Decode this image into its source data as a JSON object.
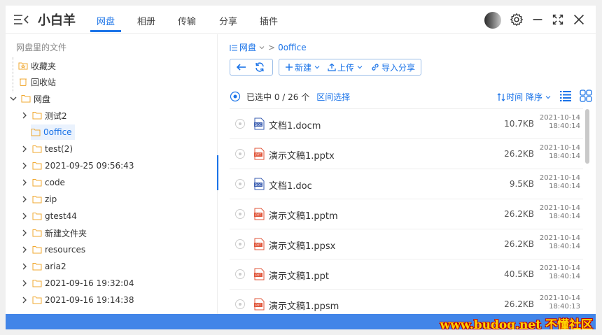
{
  "header": {
    "app_title": "小白羊",
    "tabs": [
      "网盘",
      "相册",
      "传输",
      "分享",
      "插件"
    ],
    "active_tab": "网盘"
  },
  "sidebar": {
    "title": "网盘里的文件",
    "favorites": "收藏夹",
    "recycle": "回收站",
    "root": "网盘",
    "folders": [
      {
        "label": "测试2",
        "selected": false
      },
      {
        "label": "0office",
        "selected": true
      },
      {
        "label": "test(2)",
        "selected": false
      },
      {
        "label": "2021-09-25 09:56:43",
        "selected": false
      },
      {
        "label": "code",
        "selected": false
      },
      {
        "label": "zip",
        "selected": false
      },
      {
        "label": "gtest44",
        "selected": false
      },
      {
        "label": "新建文件夹",
        "selected": false
      },
      {
        "label": "resources",
        "selected": false
      },
      {
        "label": "aria2",
        "selected": false
      },
      {
        "label": "2021-09-16 19:32:04",
        "selected": false
      },
      {
        "label": "2021-09-16 19:14:38",
        "selected": false
      }
    ]
  },
  "main": {
    "breadcrumb": {
      "root": "网盘",
      "current": "0office"
    },
    "toolbar": {
      "new": "新建",
      "upload": "上传",
      "import": "导入分享"
    },
    "selection": {
      "text": "已选中 0 / 26 个",
      "range_select": "区间选择"
    },
    "sort": {
      "label": "时间 降序"
    },
    "files": [
      {
        "name": "文档1.docm",
        "size": "10.7KB",
        "date": "2021-10-14",
        "time": "18:40:14",
        "type": "doc"
      },
      {
        "name": "演示文稿1.pptx",
        "size": "26.2KB",
        "date": "2021-10-14",
        "time": "18:40:14",
        "type": "ppt"
      },
      {
        "name": "文档1.doc",
        "size": "9.5KB",
        "date": "2021-10-14",
        "time": "18:40:14",
        "type": "doc"
      },
      {
        "name": "演示文稿1.pptm",
        "size": "26.2KB",
        "date": "2021-10-14",
        "time": "18:40:14",
        "type": "ppt"
      },
      {
        "name": "演示文稿1.ppsx",
        "size": "26.2KB",
        "date": "2021-10-14",
        "time": "18:40:14",
        "type": "ppt"
      },
      {
        "name": "演示文稿1.ppt",
        "size": "40.5KB",
        "date": "2021-10-14",
        "time": "18:40:14",
        "type": "ppt"
      },
      {
        "name": "演示文稿1.ppsm",
        "size": "26.2KB",
        "date": "2021-10-14",
        "time": "18:40:13",
        "type": "ppt"
      }
    ]
  },
  "footer": {
    "watermark": "www.budog.net 不懂社区"
  },
  "colors": {
    "accent": "#1a73e8",
    "footer": "#4285e8",
    "folder": "#f0a830",
    "ppt": "#e0553a",
    "doc": "#3a5db0"
  },
  "icons": {
    "menu": "menu-icon",
    "settings": "gear-icon",
    "minimize": "minimize-icon",
    "maximize": "maximize-icon",
    "close": "close-icon",
    "back": "arrow-left-icon",
    "refresh": "refresh-icon",
    "plus": "plus-icon",
    "upload": "upload-icon",
    "link": "link-icon",
    "list_view": "list-view-icon",
    "grid_view": "grid-view-icon"
  }
}
